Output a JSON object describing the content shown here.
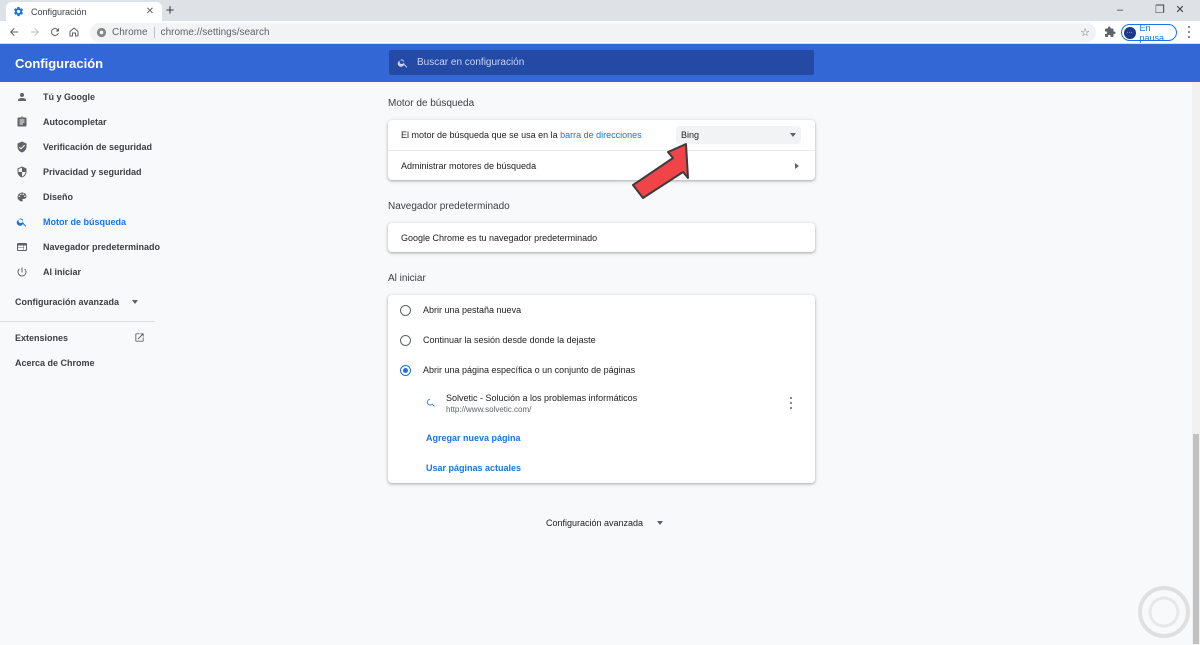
{
  "browser": {
    "tab": {
      "title": "Configuración",
      "icon": "gear-icon"
    },
    "window_controls": {
      "minimize": "–",
      "restore": "❐",
      "close": "✕"
    },
    "omnibox": {
      "site_chip": "Chrome",
      "url": "chrome://settings/search"
    },
    "profile": {
      "label": "En pausa"
    }
  },
  "header": {
    "title": "Configuración",
    "search_placeholder": "Buscar en configuración"
  },
  "sidebar": {
    "items": [
      {
        "label": "Tú y Google",
        "icon": "person-icon"
      },
      {
        "label": "Autocompletar",
        "icon": "clipboard-icon"
      },
      {
        "label": "Verificación de seguridad",
        "icon": "shield-check-icon"
      },
      {
        "label": "Privacidad y seguridad",
        "icon": "shield-icon"
      },
      {
        "label": "Diseño",
        "icon": "palette-icon"
      },
      {
        "label": "Motor de búsqueda",
        "icon": "search-icon",
        "active": true
      },
      {
        "label": "Navegador predeterminado",
        "icon": "browser-window-icon"
      },
      {
        "label": "Al iniciar",
        "icon": "power-icon"
      }
    ],
    "advanced": "Configuración avanzada",
    "extensions": "Extensiones",
    "about": "Acerca de Chrome"
  },
  "search_engine": {
    "section_title": "Motor de búsqueda",
    "engine_label_prefix": "El motor de búsqueda que se usa en la",
    "engine_label_link": "barra de direcciones",
    "selected_engine": "Bing",
    "manage_label": "Administrar motores de búsqueda"
  },
  "default_browser": {
    "section_title": "Navegador predeterminado",
    "status": "Google Chrome es tu navegador predeterminado"
  },
  "on_startup": {
    "section_title": "Al iniciar",
    "options": [
      {
        "label": "Abrir una pestaña nueva",
        "checked": false
      },
      {
        "label": "Continuar la sesión desde donde la dejaste",
        "checked": false
      },
      {
        "label": "Abrir una página específica o un conjunto de páginas",
        "checked": true
      }
    ],
    "page": {
      "title": "Solvetic - Solución a los problemas informáticos",
      "url": "http://www.solvetic.com/"
    },
    "add_page": "Agregar nueva página",
    "use_current": "Usar páginas actuales"
  },
  "advanced_bottom": "Configuración avanzada",
  "colors": {
    "header": "#3367d6",
    "accent": "#1a73e8",
    "arrow": "#f04449"
  }
}
